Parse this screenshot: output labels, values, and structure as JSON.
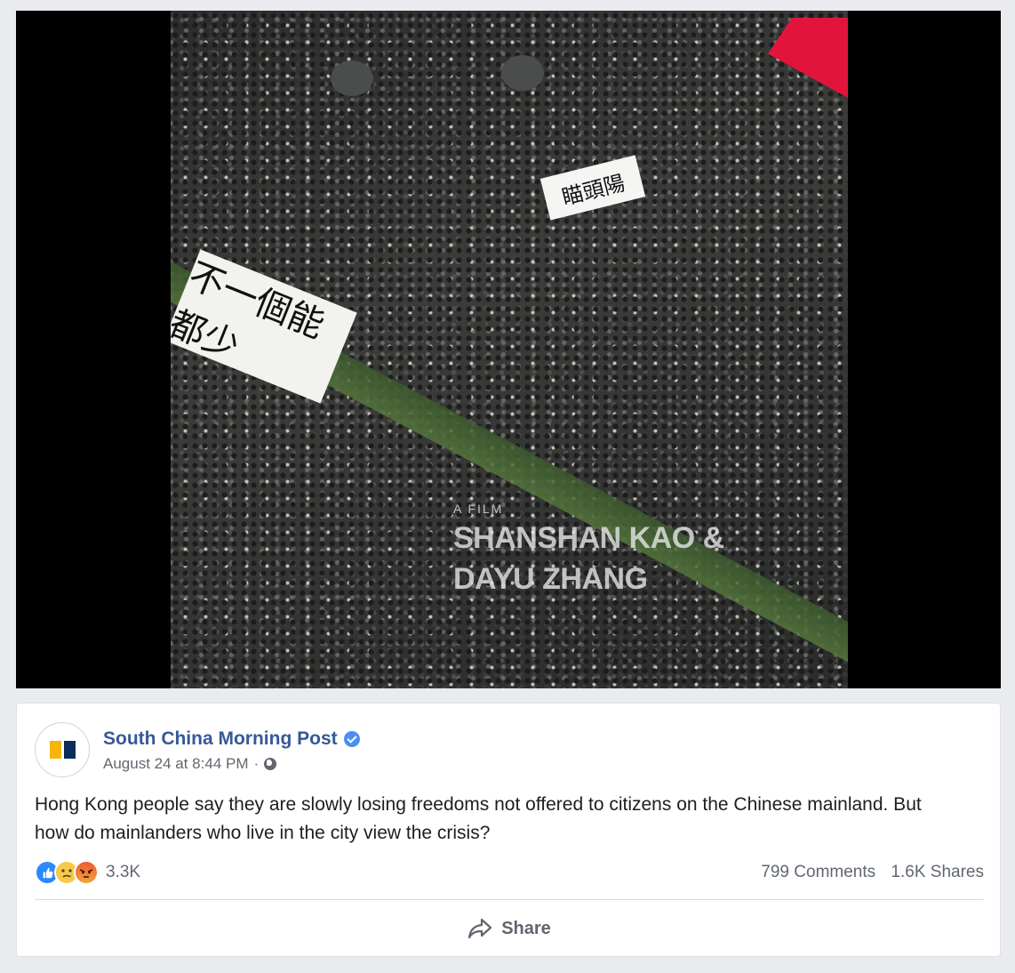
{
  "video": {
    "banner_left_text": "不一個能都少",
    "banner_center_text": "瞄頭陽",
    "watermark_prefix": "A FILM",
    "watermark_line1": "SHANSHAN KAO &",
    "watermark_line2": "DAYU ZHANG"
  },
  "post": {
    "page_name": "South China Morning Post",
    "date": "August 24 at 8:44 PM",
    "separator": "·",
    "text": "Hong Kong people say they are slowly losing freedoms not offered to citizens on the Chinese mainland. But how do mainlanders who live in the city view the crisis?",
    "reactions_count": "3.3K",
    "comments": "799 Comments",
    "shares": "1.6K Shares",
    "share_label": "Share",
    "icons": [
      "verified-badge-icon",
      "globe-icon",
      "like-reaction-icon",
      "sad-reaction-icon",
      "angry-reaction-icon",
      "share-arrow-icon"
    ]
  },
  "colors": {
    "link": "#385898",
    "background": "#e9ebee",
    "logo_yellow": "#f5b50a",
    "logo_navy": "#0c2c5c"
  }
}
